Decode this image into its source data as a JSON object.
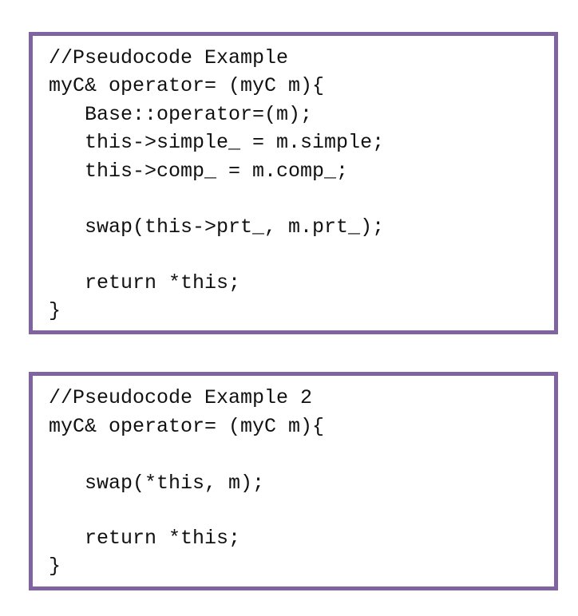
{
  "snippet1": {
    "lines": [
      "//Pseudocode Example",
      "myC& operator= (myC m){",
      "   Base::operator=(m);",
      "   this->simple_ = m.simple;",
      "   this->comp_ = m.comp_;",
      "",
      "   swap(this->prt_, m.prt_);",
      "",
      "   return *this;",
      "}"
    ]
  },
  "snippet2": {
    "lines": [
      "//Pseudocode Example 2",
      "myC& operator= (myC m){",
      "",
      "   swap(*this, m);",
      "",
      "   return *this;",
      "}"
    ]
  },
  "colors": {
    "border": "#8064a2",
    "text": "#111111",
    "background": "#ffffff"
  }
}
